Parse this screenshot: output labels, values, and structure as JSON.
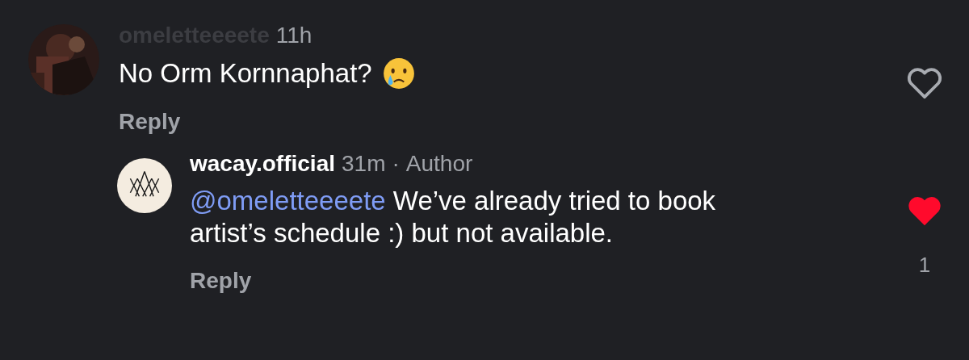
{
  "comments": [
    {
      "username": "omeletteeeete",
      "username_dimmed": true,
      "time": "11h",
      "text": "No Orm Kornnaphat?",
      "emoji": {
        "kind": "crying-face"
      },
      "reply": "Reply",
      "liked": false
    },
    {
      "username": "wacay.official",
      "username_dimmed": false,
      "time": "31m",
      "separator": "·",
      "role": "Author",
      "mention": "@omeletteeeete",
      "text": "We’ve already tried to book artist’s schedule :) but not available.",
      "reply": "Reply",
      "liked": true,
      "like_count": "1",
      "avatar": {
        "kind": "logo"
      }
    }
  ]
}
